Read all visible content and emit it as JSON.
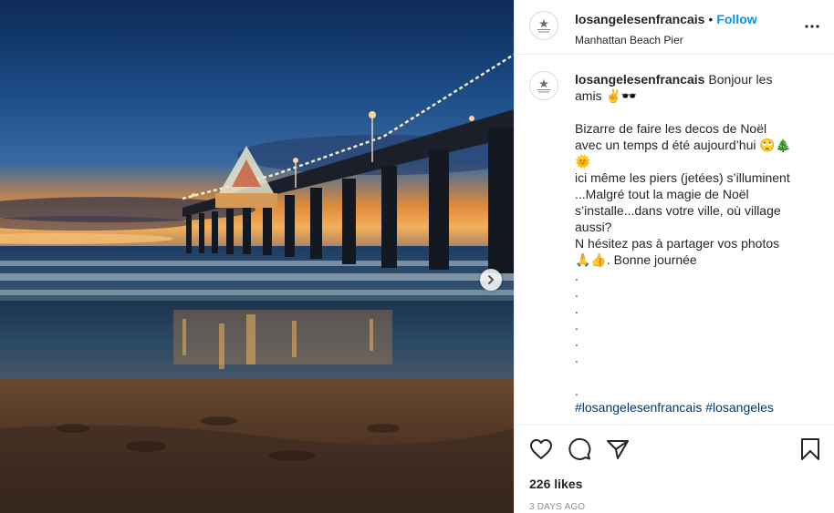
{
  "post": {
    "username": "losangelesenfrancais",
    "follow_label": "Follow",
    "separator": "•",
    "location": "Manhattan Beach Pier",
    "caption": {
      "username": "losangelesenfrancais",
      "line1": "Bonjour les amis ✌️🕶️",
      "line2": "Bizarre de faire les decos de Noël avec un temps d été aujourd’hui 🙄🎄🌞",
      "line3": "ici même les piers (jetées) s’illuminent",
      "line4": "...Malgré tout la magie de Noël s’installe...dans votre ville, où village aussi?",
      "line5": "N hésitez pas à partager vos photos 🙏👍. Bonne journée",
      "dots": [
        ".",
        ".",
        ".",
        ".",
        ".",
        "."
      ],
      "dots2": [
        "."
      ],
      "hashtags": "#losangelesenfrancais #losangeles"
    },
    "likes": "226 likes",
    "date": "3 DAYS AGO",
    "icons": {
      "more": "more-options-icon",
      "like": "heart-icon",
      "comment": "comment-icon",
      "share": "share-icon",
      "save": "bookmark-icon",
      "next": "chevron-right-icon"
    }
  },
  "colors": {
    "link": "#0095f6",
    "hashtag": "#00376b",
    "muted": "#8e8e8e"
  }
}
